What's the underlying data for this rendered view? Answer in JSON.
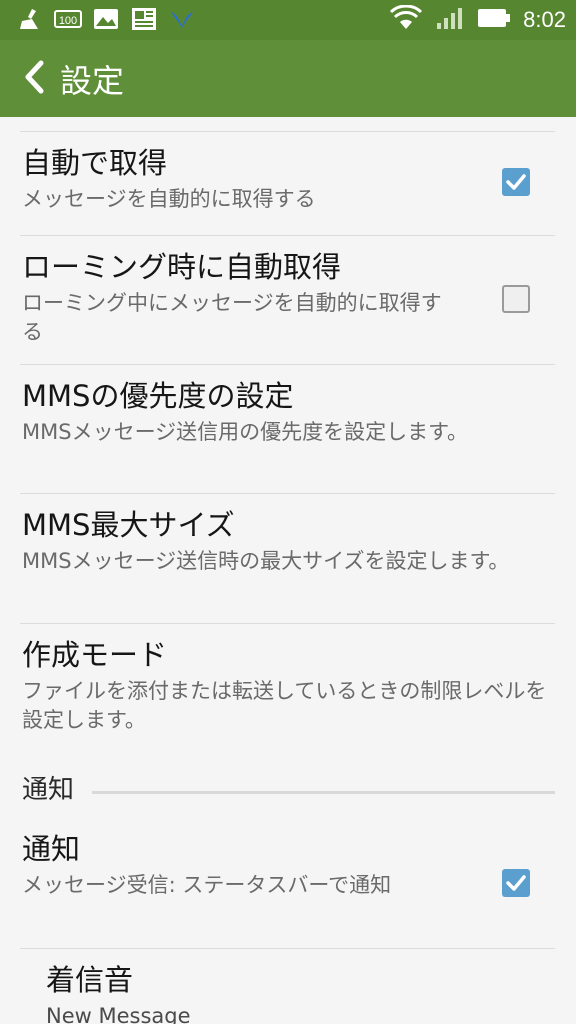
{
  "status_bar": {
    "time": "8:02",
    "icons": [
      "broom-icon",
      "data-100-icon",
      "image-icon",
      "news-icon",
      "bird-icon"
    ],
    "right_icons": [
      "wifi-icon",
      "signal-icon",
      "battery-icon"
    ]
  },
  "header": {
    "title": "設定",
    "back_icon": "chevron-left-icon",
    "bg_color": "#5f8f39"
  },
  "settings": [
    {
      "title": "自動で取得",
      "subtitle": "メッセージを自動的に取得する",
      "checkbox": true
    },
    {
      "title": "ローミング時に自動取得",
      "subtitle": "ローミング中にメッセージを自動的に取得する",
      "checkbox": false
    },
    {
      "title": "MMSの優先度の設定",
      "subtitle": "MMSメッセージ送信用の優先度を設定します。"
    },
    {
      "title": "MMS最大サイズ",
      "subtitle": "MMSメッセージ送信時の最大サイズを設定します。"
    },
    {
      "title": "作成モード",
      "subtitle": "ファイルを添付または転送しているときの制限レベルを設定します。"
    }
  ],
  "notifications_section": {
    "header": "通知",
    "items": [
      {
        "title": "通知",
        "subtitle": "メッセージ受信: ステータスバーで通知",
        "checkbox": true
      },
      {
        "title": "着信音",
        "subtitle": "New Message"
      }
    ]
  },
  "colors": {
    "accent": "#56862f",
    "checkbox_checked": "#5b9fcf"
  }
}
